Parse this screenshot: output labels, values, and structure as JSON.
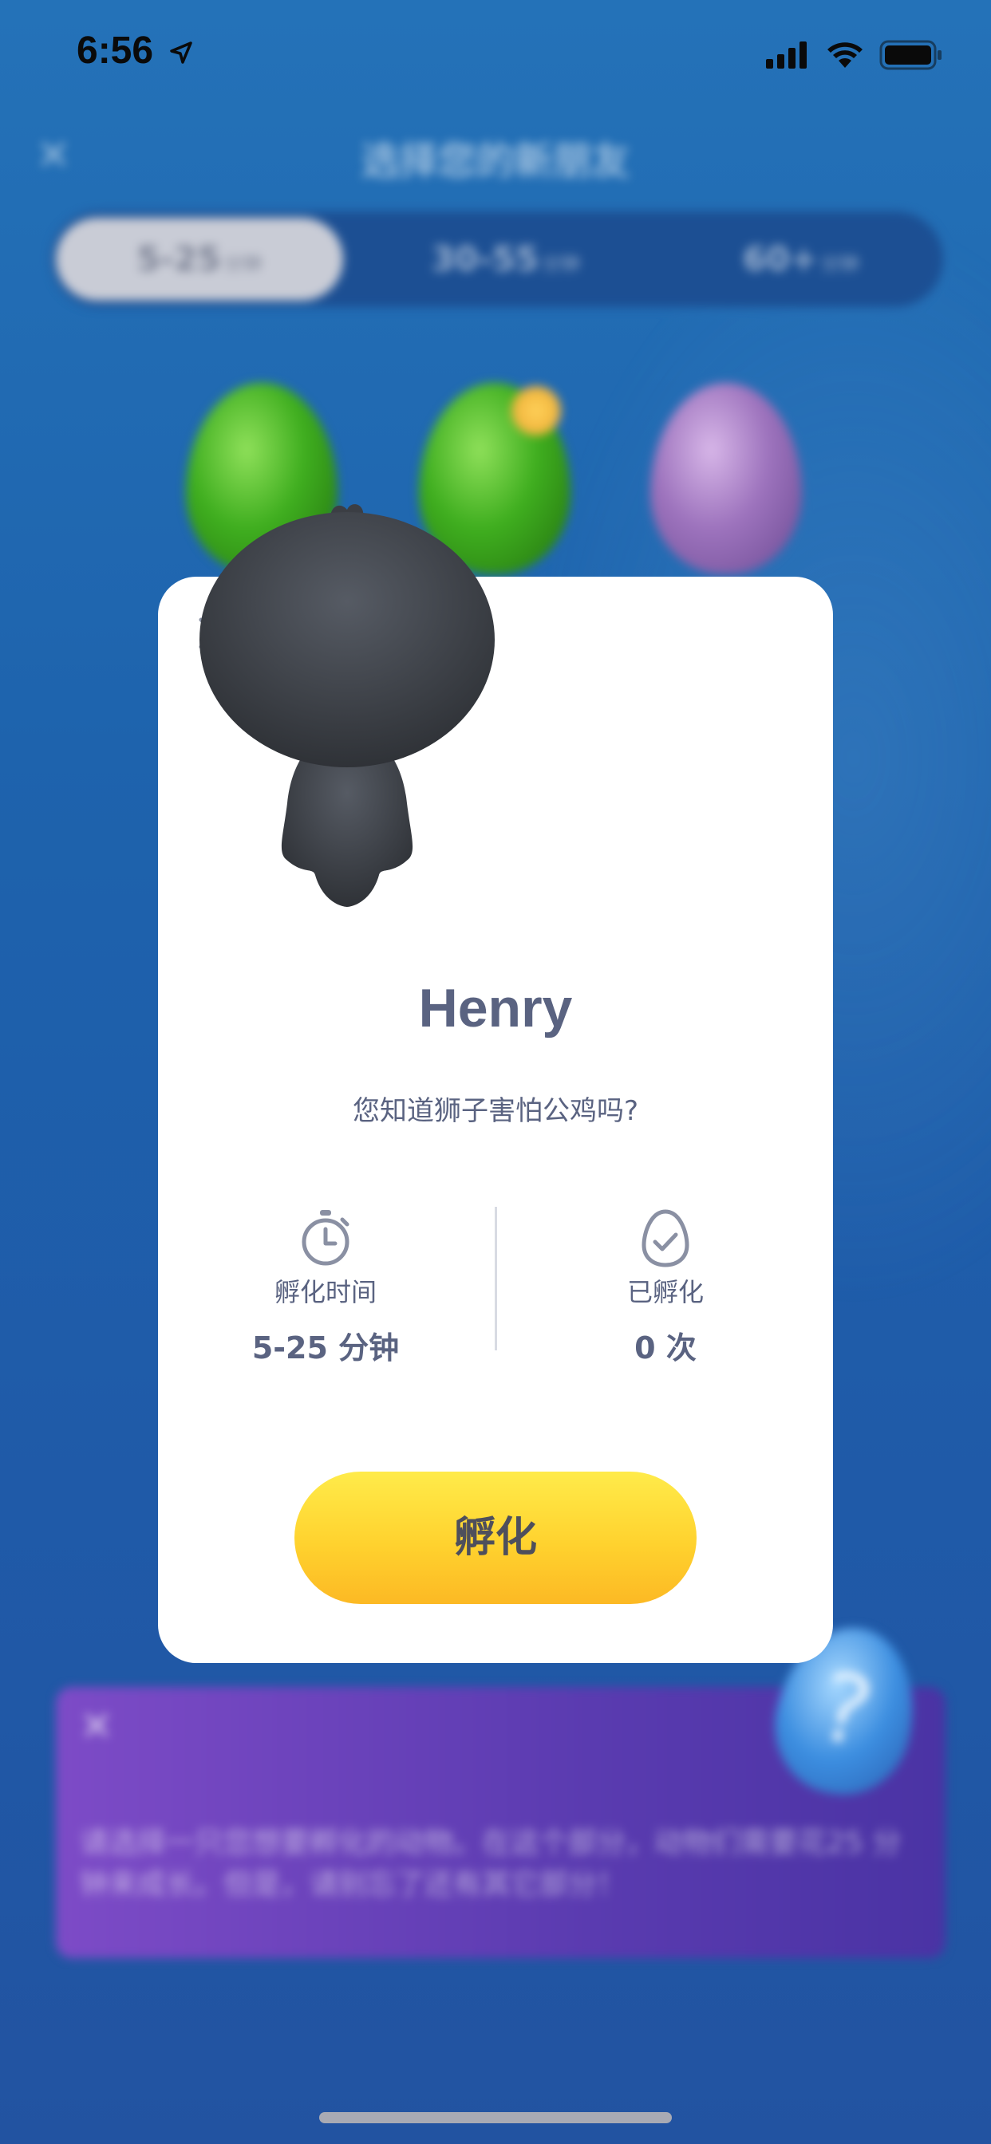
{
  "status_bar": {
    "time": "6:56"
  },
  "background_screen": {
    "title": "选择您的新朋友",
    "tabs": [
      {
        "label": "5-25",
        "unit": "分钟"
      },
      {
        "label": "30-55",
        "unit": "分钟"
      },
      {
        "label": "60+",
        "unit": "分钟"
      }
    ],
    "info_text": "请选择一只您想要孵化的动物。在这个部分，动物们需要花25 分钟来成长。但是，请别忘了还有其它部分！"
  },
  "modal": {
    "animal_name": "Henry",
    "fact": "您知道狮子害怕公鸡吗?",
    "hatch_time": {
      "label": "孵化时间",
      "value": "5-25 分钟"
    },
    "hatched": {
      "label": "已孵化",
      "value": "0 次"
    },
    "hatch_button": "孵化"
  },
  "colors": {
    "text_primary": "#5a6381",
    "button_yellow": "#ffd22e",
    "background_blue": "#1f5fb0"
  },
  "icons": {
    "close": "close-icon",
    "timer": "stopwatch-icon",
    "egg_check": "egg-check-icon"
  }
}
